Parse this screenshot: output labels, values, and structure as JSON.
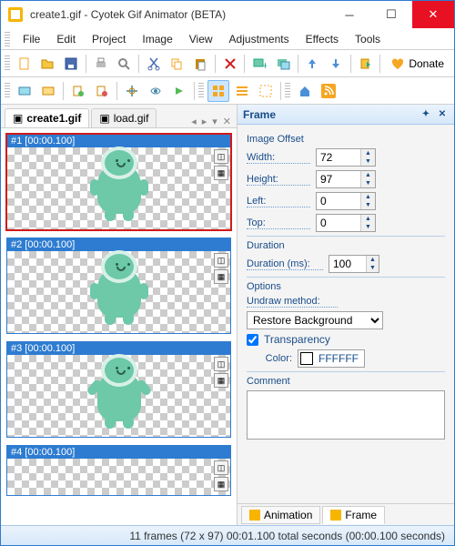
{
  "window": {
    "title": "create1.gif - Cyotek Gif Animator (BETA)"
  },
  "menu": [
    "File",
    "Edit",
    "Project",
    "Image",
    "View",
    "Adjustments",
    "Effects",
    "Tools"
  ],
  "donate": "Donate",
  "tabs": {
    "active": "create1.gif",
    "inactive": "load.gif"
  },
  "frames": [
    {
      "label": "#1 [00:00.100]",
      "selected": true
    },
    {
      "label": "#2 [00:00.100]",
      "selected": false
    },
    {
      "label": "#3 [00:00.100]",
      "selected": false
    },
    {
      "label": "#4 [00:00.100]",
      "selected": false
    }
  ],
  "panel": {
    "title": "Frame",
    "offset": {
      "label": "Image Offset",
      "width_l": "Width:",
      "width": "72",
      "height_l": "Height:",
      "height": "97",
      "left_l": "Left:",
      "left": "0",
      "top_l": "Top:",
      "top": "0"
    },
    "duration": {
      "group": "Duration",
      "label": "Duration (ms):",
      "value": "100"
    },
    "options": {
      "group": "Options",
      "undraw_l": "Undraw method:",
      "undraw": "Restore Background",
      "transparency": "Transparency",
      "color_l": "Color:",
      "color": "FFFFFF"
    },
    "comment": {
      "group": "Comment",
      "value": ""
    },
    "bottom": {
      "animation": "Animation",
      "frame": "Frame"
    }
  },
  "status": "11 frames (72 x 97)   00:01.100 total seconds (00:00.100 seconds)"
}
